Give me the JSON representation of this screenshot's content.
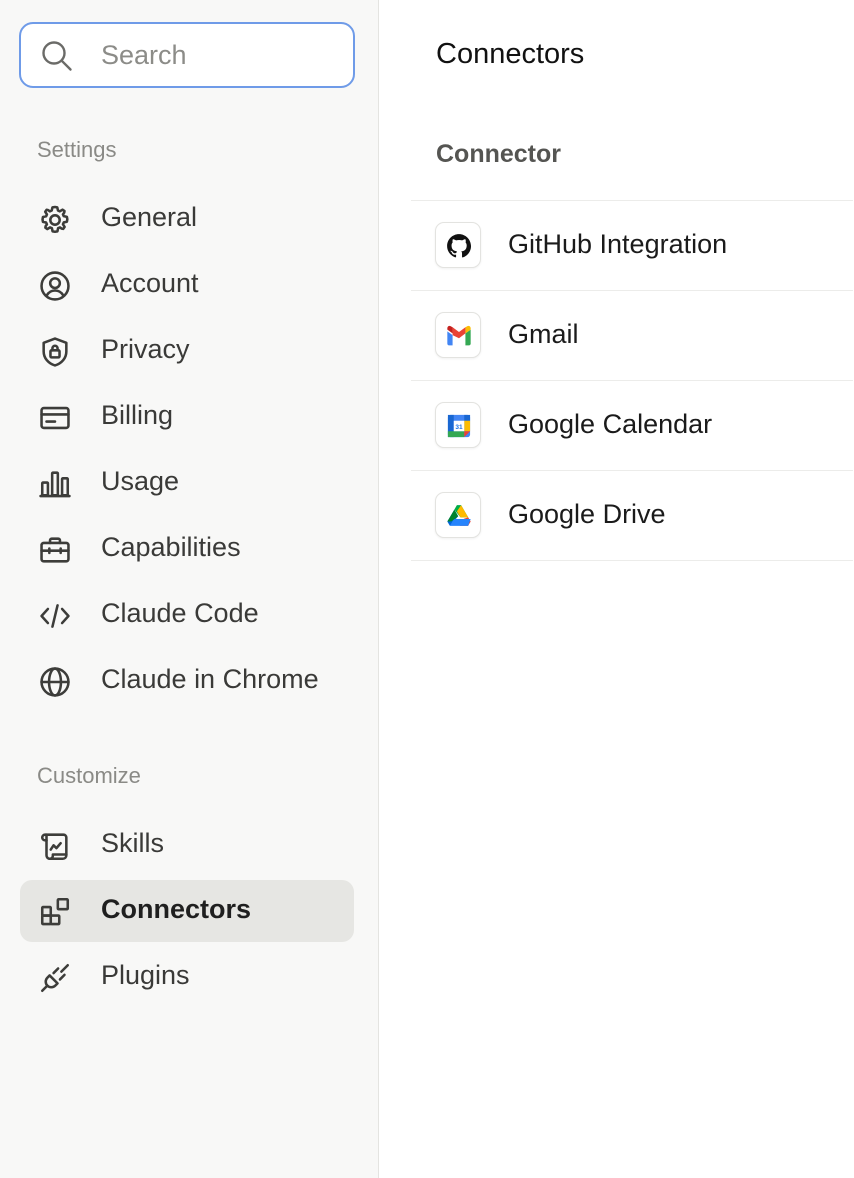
{
  "sidebar": {
    "search": {
      "placeholder": "Search",
      "value": ""
    },
    "sections": [
      {
        "label": "Settings",
        "items": [
          {
            "label": "General",
            "icon": "gear-icon"
          },
          {
            "label": "Account",
            "icon": "user-circle-icon"
          },
          {
            "label": "Privacy",
            "icon": "shield-lock-icon"
          },
          {
            "label": "Billing",
            "icon": "credit-card-icon"
          },
          {
            "label": "Usage",
            "icon": "bar-chart-icon"
          },
          {
            "label": "Capabilities",
            "icon": "briefcase-icon"
          },
          {
            "label": "Claude Code",
            "icon": "code-icon"
          },
          {
            "label": "Claude in Chrome",
            "icon": "globe-icon"
          }
        ]
      },
      {
        "label": "Customize",
        "items": [
          {
            "label": "Skills",
            "icon": "scroll-icon"
          },
          {
            "label": "Connectors",
            "icon": "blocks-icon",
            "active": true
          },
          {
            "label": "Plugins",
            "icon": "plug-icon"
          }
        ]
      }
    ]
  },
  "main": {
    "title": "Connectors",
    "column_header": "Connector",
    "connectors": [
      {
        "name": "GitHub Integration",
        "icon": "github-icon"
      },
      {
        "name": "Gmail",
        "icon": "gmail-icon"
      },
      {
        "name": "Google Calendar",
        "icon": "google-calendar-icon",
        "calendar_day": "31"
      },
      {
        "name": "Google Drive",
        "icon": "google-drive-icon"
      }
    ]
  },
  "colors": {
    "sidebar_bg": "#f8f8f7",
    "active_item_bg": "#e6e6e3",
    "search_border": "#6f9be8"
  }
}
